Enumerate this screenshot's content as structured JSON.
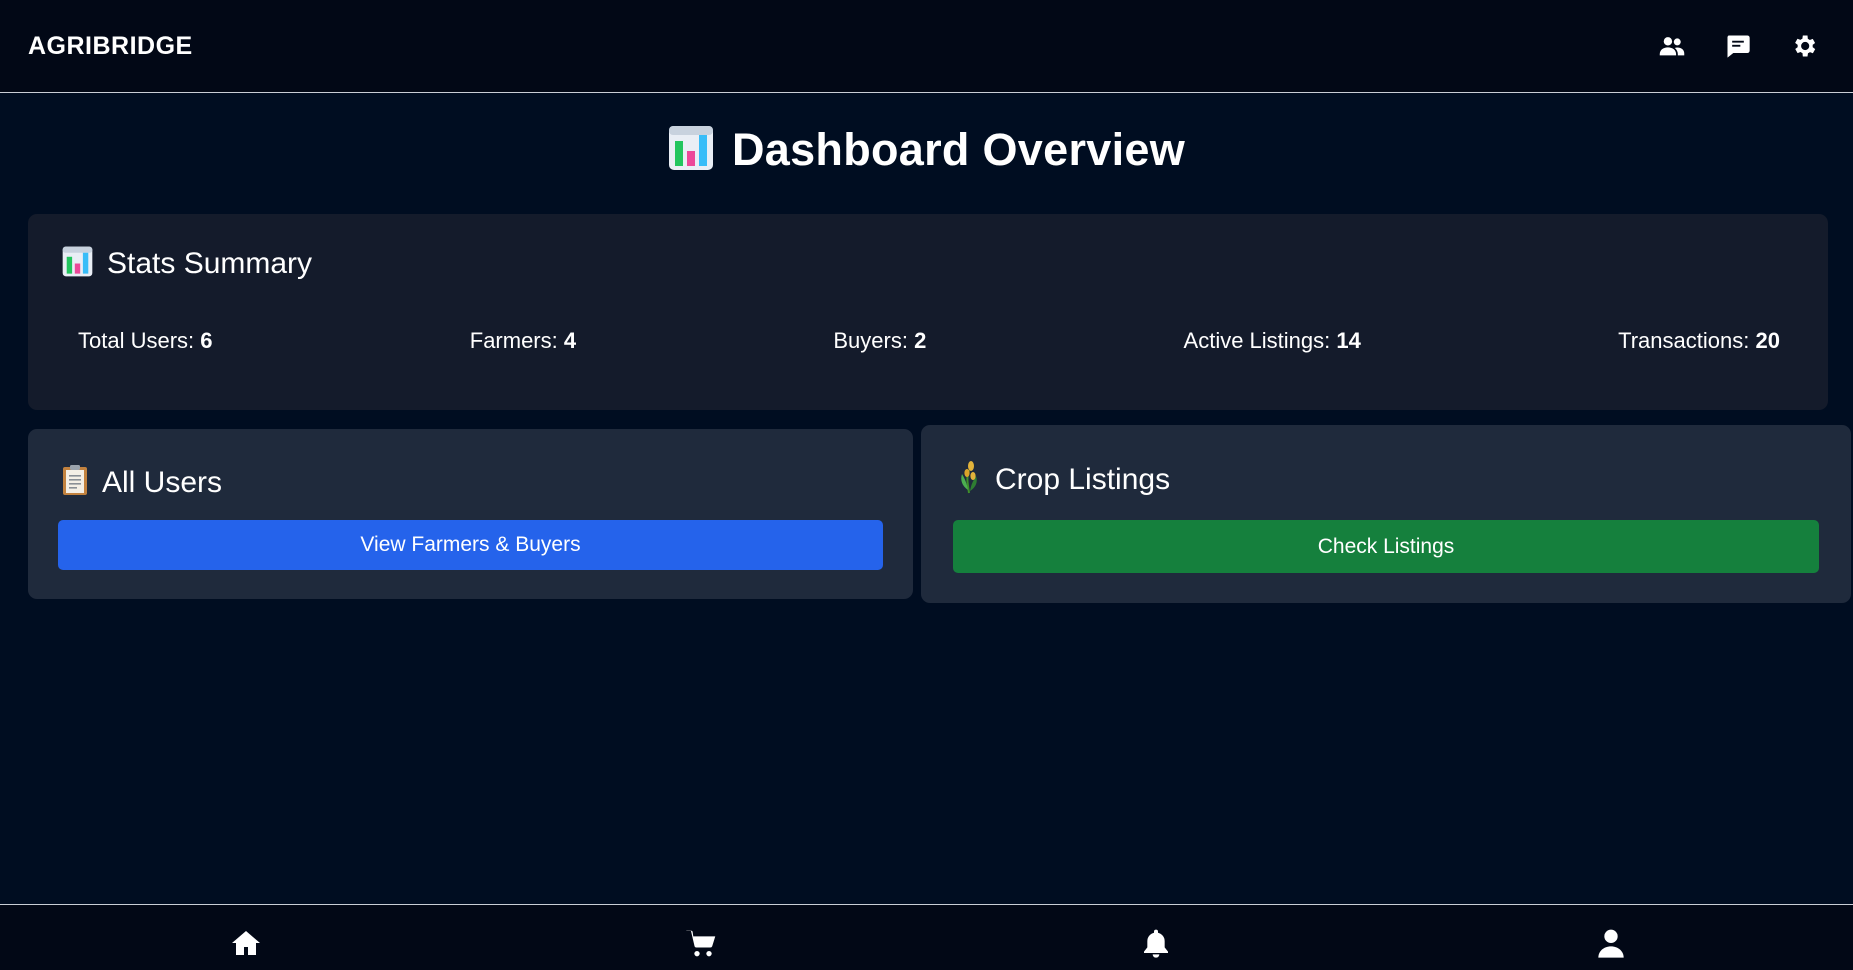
{
  "header": {
    "brand": "AGRIBRIDGE",
    "icons": [
      "users-icon",
      "chat-icon",
      "gear-icon"
    ]
  },
  "page": {
    "title": "Dashboard Overview",
    "title_icon": "bar-chart-icon"
  },
  "stats": {
    "title": "Stats Summary",
    "items": [
      {
        "label": "Total Users:",
        "value": "6"
      },
      {
        "label": "Farmers:",
        "value": "4"
      },
      {
        "label": "Buyers:",
        "value": "2"
      },
      {
        "label": "Active Listings:",
        "value": "14"
      },
      {
        "label": "Transactions:",
        "value": "20"
      }
    ]
  },
  "users_card": {
    "title": "All Users",
    "icon": "clipboard-icon",
    "button_label": "View Farmers & Buyers"
  },
  "crops_card": {
    "title": "Crop Listings",
    "icon": "crop-icon",
    "button_label": "Check Listings"
  },
  "bottom_nav": [
    "home-icon",
    "cart-icon",
    "bell-icon",
    "profile-icon"
  ],
  "colors": {
    "background": "#000d21",
    "card": "#141b2b",
    "card_secondary": "#1f2a3c",
    "blue_button": "#2563eb",
    "green_button": "#15803d"
  }
}
